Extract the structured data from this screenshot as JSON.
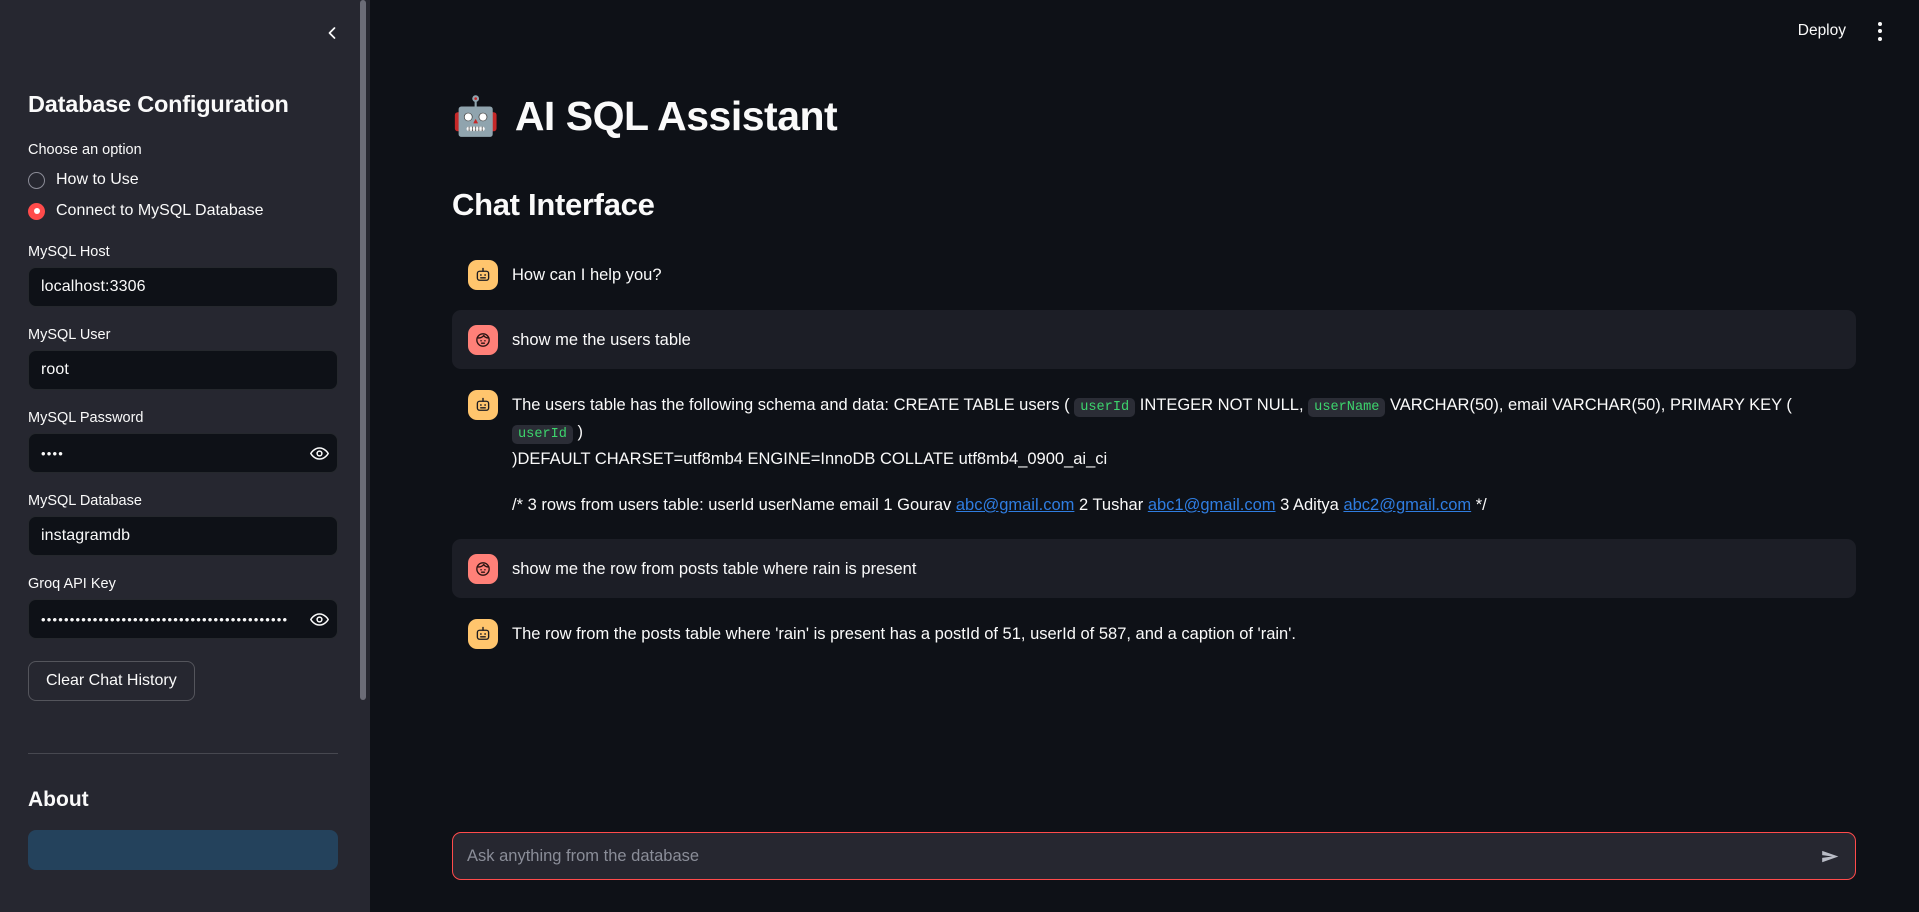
{
  "sidebar": {
    "collapse_icon": "chevron-left-icon",
    "title": "Database Configuration",
    "choose_label": "Choose an option",
    "options": [
      {
        "label": "How to Use",
        "selected": false
      },
      {
        "label": "Connect to MySQL Database",
        "selected": true
      }
    ],
    "fields": [
      {
        "label": "MySQL Host",
        "value": "localhost:3306",
        "masked": false
      },
      {
        "label": "MySQL User",
        "value": "root",
        "masked": false
      },
      {
        "label": "MySQL Password",
        "value": "••••",
        "masked": true
      },
      {
        "label": "MySQL Database",
        "value": "instagramdb",
        "masked": false
      },
      {
        "label": "Groq API Key",
        "value": "•••••••••••••••••••••••••••••••••••••••••••",
        "masked": true
      }
    ],
    "clear_button": "Clear Chat History",
    "about_title": "About"
  },
  "topbar": {
    "deploy_label": "Deploy",
    "menu_icon": "kebab-menu-icon"
  },
  "main": {
    "app_emoji": "🤖",
    "app_title": "AI SQL Assistant",
    "section_title": "Chat Interface",
    "messages": [
      {
        "role": "assistant",
        "avatar": "robot-icon",
        "shaded": false,
        "text": "How can I help you?"
      },
      {
        "role": "user",
        "avatar": "user-face-icon",
        "shaded": true,
        "text": "show me the users table"
      },
      {
        "role": "assistant",
        "avatar": "robot-icon",
        "shaded": false,
        "paragraphs": [
          {
            "parts": [
              {
                "t": "text",
                "v": "The users table has the following schema and data: CREATE TABLE users ("
              },
              {
                "t": "code",
                "v": "userId"
              },
              {
                "t": "text",
                "v": "INTEGER NOT NULL,"
              },
              {
                "t": "code",
                "v": "userName"
              },
              {
                "t": "text",
                "v": "VARCHAR(50), email VARCHAR(50), PRIMARY KEY ("
              },
              {
                "t": "code",
                "v": "userId"
              },
              {
                "t": "text",
                "v": ")"
              },
              {
                "t": "br",
                "v": ""
              },
              {
                "t": "text",
                "v": ")DEFAULT CHARSET=utf8mb4 ENGINE=InnoDB COLLATE utf8mb4_0900_ai_ci"
              }
            ]
          },
          {
            "parts": [
              {
                "t": "text",
                "v": "/* 3 rows from users table: userId userName email 1 Gourav"
              },
              {
                "t": "link",
                "v": "abc@gmail.com"
              },
              {
                "t": "text",
                "v": "2 Tushar"
              },
              {
                "t": "link",
                "v": "abc1@gmail.com"
              },
              {
                "t": "text",
                "v": "3 Aditya"
              },
              {
                "t": "link",
                "v": "abc2@gmail.com"
              },
              {
                "t": "text",
                "v": "*/"
              }
            ]
          }
        ]
      },
      {
        "role": "user",
        "avatar": "user-face-icon",
        "shaded": true,
        "text": "show me the row from posts table where rain is present"
      },
      {
        "role": "assistant",
        "avatar": "robot-icon",
        "shaded": false,
        "text": "The row from the posts table where 'rain' is present has a postId of 51, userId of 587, and a caption of 'rain'."
      }
    ],
    "chat_input": {
      "value": "",
      "placeholder": "Ask anything from the database",
      "send_icon": "send-arrow-icon"
    }
  },
  "colors": {
    "accent_red": "#ff4b4b",
    "bot_avatar": "#ffc56d",
    "user_avatar": "#ff8078",
    "code_green": "#3dd56d",
    "link_blue": "#2f7de1",
    "sidebar_bg": "#262730",
    "main_bg": "#0e1117",
    "about_box": "#24425c"
  }
}
